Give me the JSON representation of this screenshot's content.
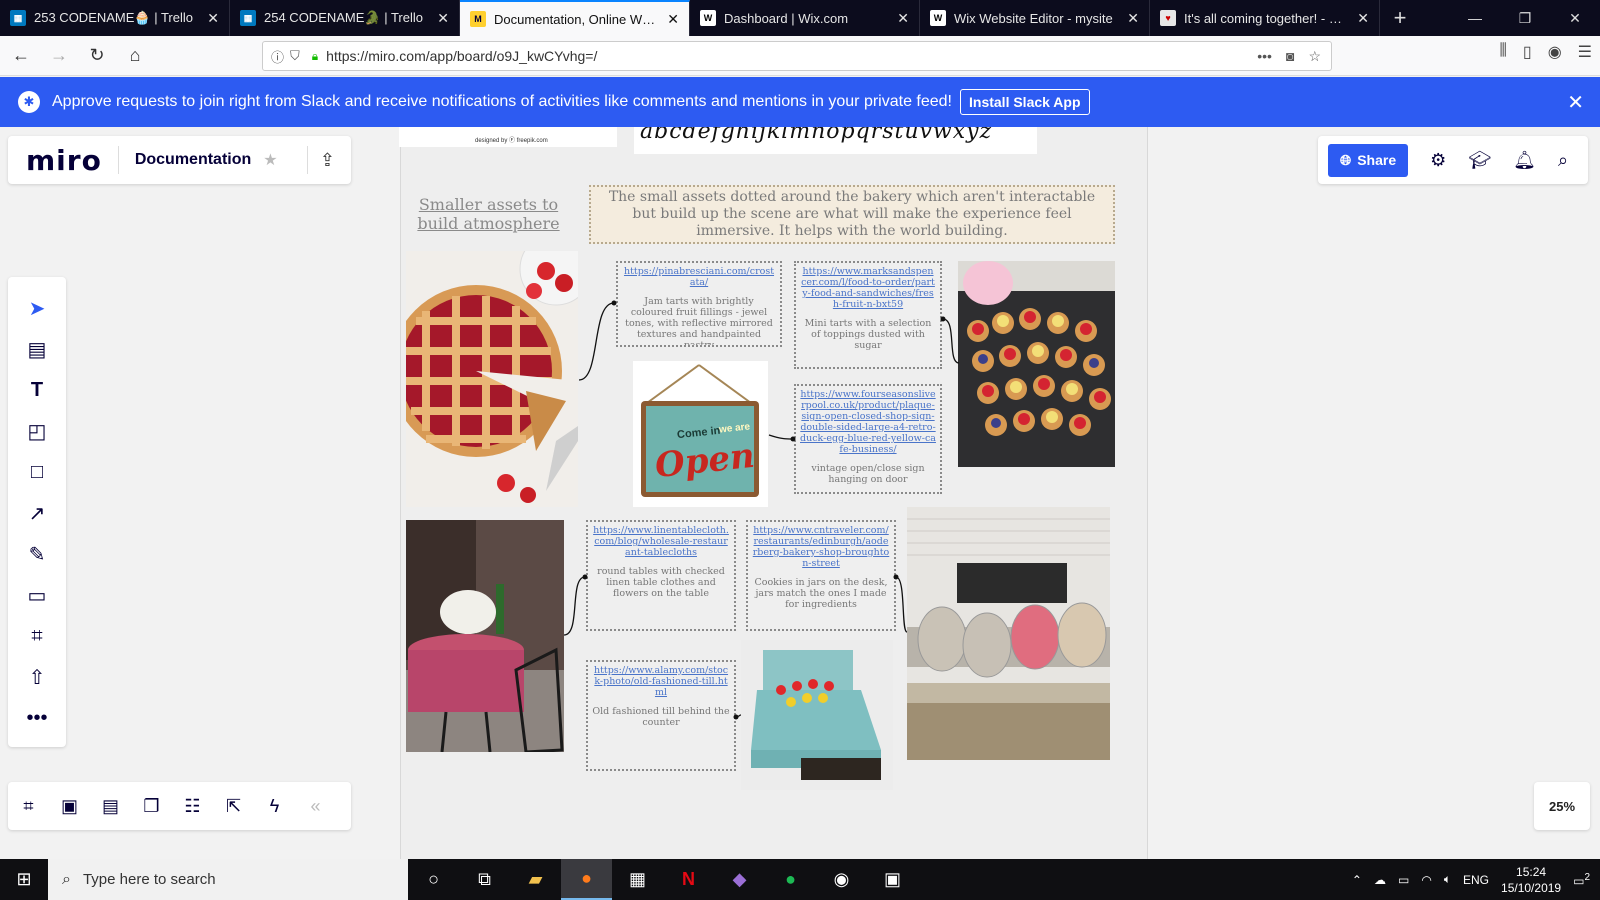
{
  "browser": {
    "tabs": [
      {
        "title": "253 CODENAME🧁 | Trello",
        "icon": "trello-icon",
        "active": false
      },
      {
        "title": "254 CODENAME🐊 | Trello",
        "icon": "trello-icon",
        "active": false
      },
      {
        "title": "Documentation, Online Whiteb",
        "icon": "miro-icon",
        "active": true
      },
      {
        "title": "Dashboard | Wix.com",
        "icon": "wix-icon",
        "active": false
      },
      {
        "title": "Wix Website Editor - mysite",
        "icon": "wix-icon",
        "active": false
      },
      {
        "title": "It's all coming together! - Wee",
        "icon": "web-icon",
        "active": false
      }
    ],
    "url": "https://miro.com/app/board/o9J_kwCYvhg=/"
  },
  "banner": {
    "text": "Approve requests to join right from Slack and receive notifications of activities like comments and mentions in your private feed!",
    "button": "Install Slack App"
  },
  "miro": {
    "logo": "miro",
    "board_title": "Documentation",
    "share_label": "Share",
    "zoom": "25%"
  },
  "board": {
    "script_alphabet": "abcdefghijklmnopqrstuvwxyz",
    "credit": "designed by Ⓕ freepik.com",
    "heading": "Smaller assets to build atmosphere",
    "description": "The small assets dotted around the bakery which aren't interactable but build up the scene are what will make the experience feel immersive. It helps with the world building.",
    "notes": [
      {
        "link": "https://pinabresciani.com/crostata/",
        "text": "Jam tarts with brightly coloured fruit fillings - jewel tones, with reflective mirrored textures and handpainted pastry"
      },
      {
        "link": "https://www.marksandspencer.com/l/food-to-order/party-food-and-sandwiches/fresh-fruit-n-bxt59",
        "text": "Mini tarts with a selection of toppings dusted with sugar"
      },
      {
        "link": "https://www.fourseasonsliverpool.co.uk/product/plaque-sign-open-closed-shop-sign-double-sided-large-a4-retro-duck-egg-blue-red-yellow-cafe-business/",
        "text": "vintage open/close sign hanging on door"
      },
      {
        "link": "https://www.linentablecloth.com/blog/wholesale-restaurant-tablecloths",
        "text": "round tables with checked linen table clothes and flowers on the table"
      },
      {
        "link": "https://www.cntraveler.com/restaurants/edinburgh/aoderberg-bakery-shop-broughton-street",
        "text": "Cookies in jars on the desk, jars match the ones I made for ingredients"
      },
      {
        "link": "https://www.alamy.com/stock-photo/old-fashioned-till.html",
        "text": "Old fashioned till behind the counter"
      }
    ],
    "sign_text_1": "Come in",
    "sign_text_2": "we are",
    "sign_text_3": "Open"
  },
  "taskbar": {
    "search_placeholder": "Type here to search",
    "lang": "ENG",
    "time": "15:24",
    "date": "15/10/2019",
    "notif_count": "2"
  }
}
